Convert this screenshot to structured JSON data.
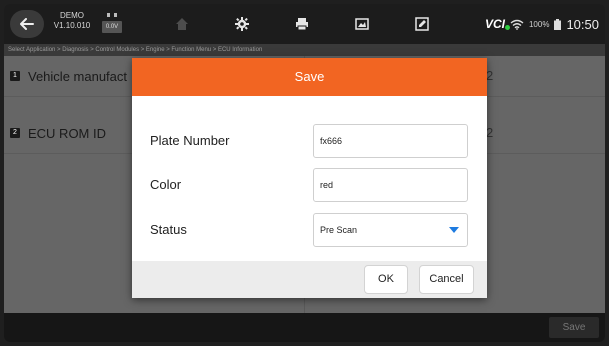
{
  "header": {
    "demo_label": "DEMO",
    "version": "V1.10.010",
    "voltage": "0.0V",
    "toolbar": [
      {
        "icon": "home-icon",
        "enabled": false
      },
      {
        "icon": "gear-icon",
        "enabled": true
      },
      {
        "icon": "print-icon",
        "enabled": true
      },
      {
        "icon": "screenshot-icon",
        "enabled": true
      },
      {
        "icon": "edit-icon",
        "enabled": true
      }
    ],
    "vci_label": "VCI",
    "battery_percent": "100%",
    "time": "10:50"
  },
  "breadcrumb": "Select Application > Diagnosis > Control Modules > Engine > Function Menu > ECU Information",
  "rows": [
    {
      "number": "1",
      "label": "Vehicle manufact",
      "value": "2"
    },
    {
      "number": "2",
      "label": "ECU ROM ID",
      "value": "2"
    }
  ],
  "bottom_bar": {
    "save_label": "Save"
  },
  "dialog": {
    "title": "Save",
    "fields": {
      "plate_label": "Plate Number",
      "plate_value": "fx666",
      "color_label": "Color",
      "color_value": "red",
      "status_label": "Status",
      "status_value": "Pre Scan"
    },
    "ok_label": "OK",
    "cancel_label": "Cancel"
  },
  "colors": {
    "accent": "#f26522",
    "dropdown_arrow": "#1e7be0",
    "vci_dot": "#2ecc40"
  }
}
